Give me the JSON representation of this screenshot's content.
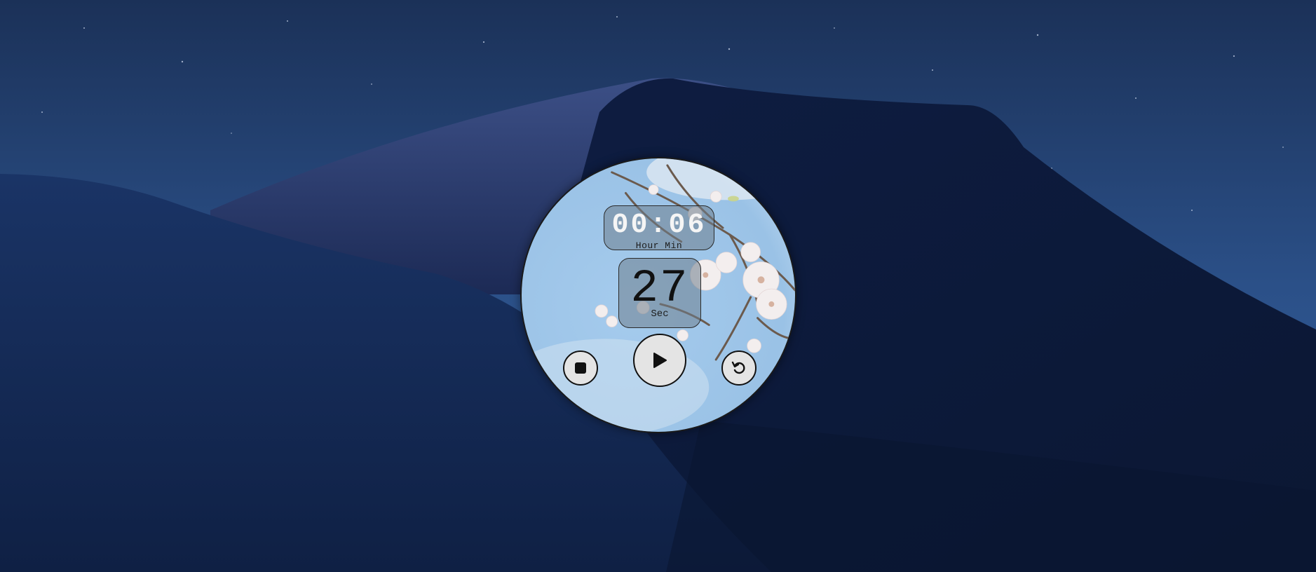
{
  "timer": {
    "hours_minutes": "00:06",
    "hours_minutes_label": "Hour Min",
    "seconds": "27",
    "seconds_label": "Sec"
  },
  "controls": {
    "stop_icon": "stop-icon",
    "play_icon": "play-icon",
    "reset_icon": "reset-icon"
  },
  "colors": {
    "sky": "#2a4d82",
    "dune_dark": "#0c1936",
    "widget_sky": "#a9cfee",
    "button_bg": "#e4e4e4"
  }
}
